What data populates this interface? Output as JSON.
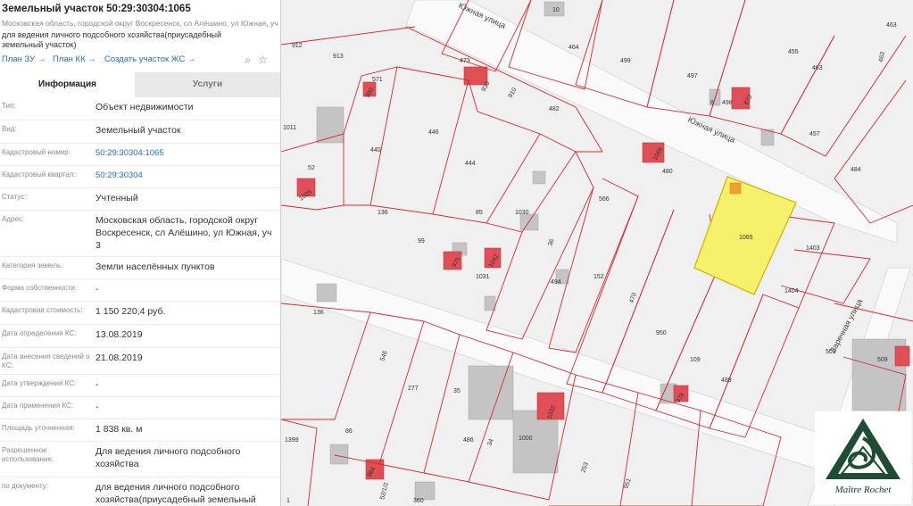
{
  "panel": {
    "title": "Земельный участок 50:29:30304:1065",
    "address": "Московская область, городской округ Воскресенск, сл Алёшино, ул Южная, уч 3",
    "purpose": "для ведения личного подсобного хозяйства(приусадебный земельный участок)",
    "links": [
      "План ЗУ →",
      "План КК →",
      "Создать участок ЖС →"
    ],
    "tabs": [
      "Информация",
      "Услуги"
    ],
    "rows": [
      {
        "label": "Тип:",
        "value": "Объект недвижимости"
      },
      {
        "label": "Вид:",
        "value": "Земельный участок"
      },
      {
        "label": "Кадастровый номер:",
        "value": "50:29:30304:1065"
      },
      {
        "label": "Кадастровый квартал:",
        "value": "50:29:30304"
      },
      {
        "label": "Статус:",
        "value": "Учтенный"
      },
      {
        "label": "Адрес:",
        "value": "Московская область, городской округ Воскресенск, сл Алёшино, ул Южная, уч 3"
      },
      {
        "label": "Категория земель:",
        "value": "Земли населённых пунктов"
      },
      {
        "label": "Форма собственности:",
        "value": "-"
      },
      {
        "label": "Кадастровая стоимость:",
        "value": "1 150 220,4 руб."
      },
      {
        "label": "Дата определения КС:",
        "value": "13.08.2019"
      },
      {
        "label": "Дата внесения сведений о КС:",
        "value": "21.08.2019"
      },
      {
        "label": "Дата утверждения КС:",
        "value": "-"
      },
      {
        "label": "Дата применения КС:",
        "value": "-"
      },
      {
        "label": "Площадь уточненная:",
        "value": "1 838 кв. м"
      },
      {
        "label": "Разрешенное использование:",
        "value": "Для ведения личного подсобного хозяйства"
      },
      {
        "label": "по документу:",
        "value": "для ведения личного подсобного хозяйства(приусадебный земельный участок)"
      }
    ]
  },
  "map": {
    "streets": [
      "Южная улица",
      "Южная улица",
      "Заречная улица"
    ],
    "plots": [
      "10",
      "912",
      "913",
      "571",
      "990",
      "930",
      "910",
      "473",
      "464",
      "499",
      "497",
      "455",
      "463",
      "463",
      "463",
      "482",
      "498",
      "873",
      "6",
      "457",
      "1011",
      "52",
      "440",
      "446",
      "444",
      "1066",
      "480",
      "484",
      "1025",
      "136",
      "85",
      "1030",
      "566",
      "1065",
      "1403",
      "99",
      "975",
      "1042",
      "36",
      "494",
      "152",
      "470",
      "1404",
      "1031",
      "136",
      "950",
      "109",
      "489",
      "509",
      "509",
      "546",
      "277",
      "35",
      "1032",
      "978",
      "1399",
      "86",
      "486",
      "34",
      "1000",
      "253",
      "951",
      "984",
      "52/1/2",
      "360",
      "1"
    ],
    "selected_plot": "1065",
    "selected_color": "#f7f06a"
  },
  "logo": {
    "caption": "Maître Rochet"
  }
}
